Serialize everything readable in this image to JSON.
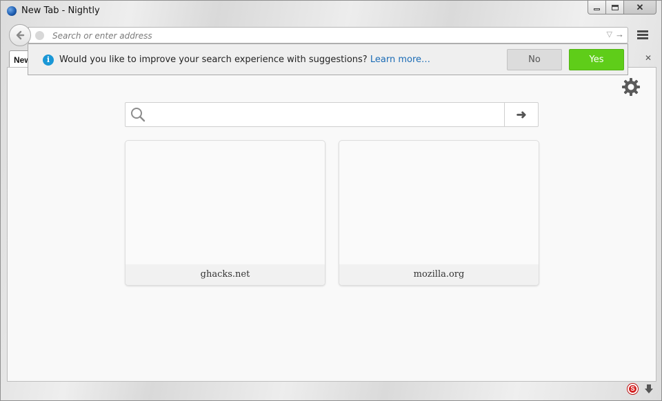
{
  "window": {
    "title": "New Tab - Nightly"
  },
  "toolbar": {
    "url_placeholder": "Search or enter address"
  },
  "tabs": [
    {
      "label": "New Tab"
    }
  ],
  "notification": {
    "message": "Would you like to improve your search experience with suggestions?",
    "link_label": "Learn more…",
    "no_label": "No",
    "yes_label": "Yes",
    "yes_color": "#5fcd19",
    "info_glyph": "i"
  },
  "newtab": {
    "search_placeholder": "",
    "tiles": [
      {
        "label": "ghacks.net"
      },
      {
        "label": "mozilla.org"
      }
    ]
  },
  "status_bar": {
    "icons": [
      "adblock-icon",
      "download-icon"
    ]
  }
}
